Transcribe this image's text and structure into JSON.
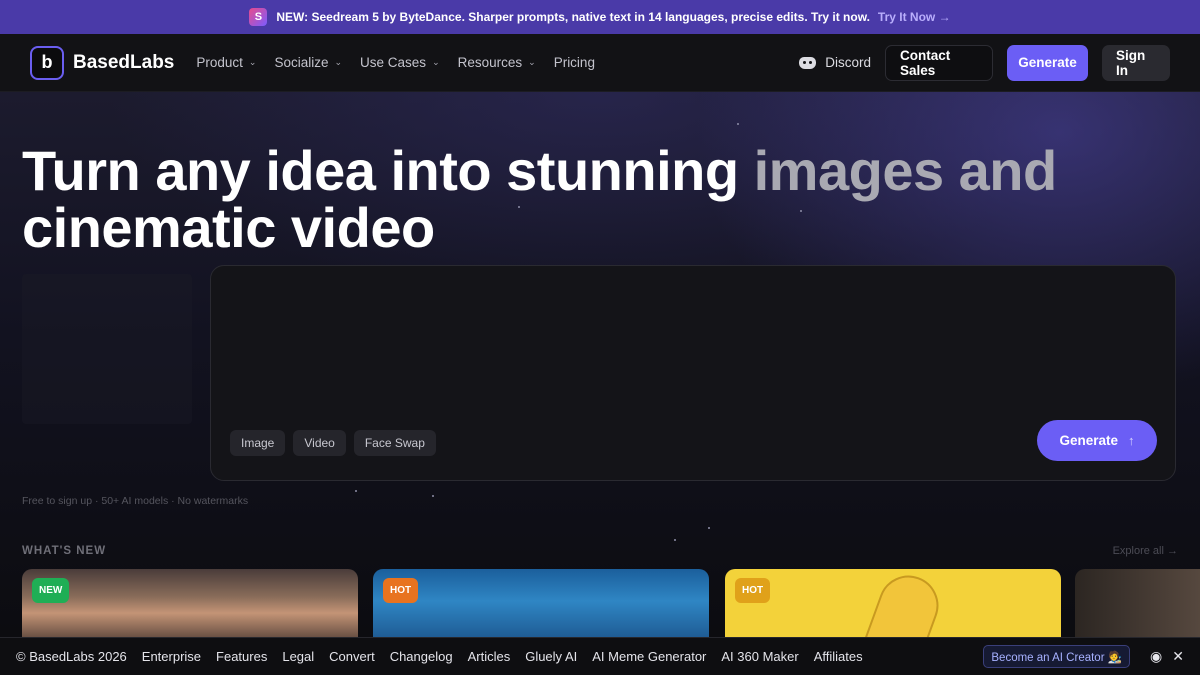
{
  "announcement": {
    "icon": "seedream-logo-icon",
    "text": "NEW: Seedream 5 by ByteDance. Sharper prompts, native text in 14 languages, precise edits. Try it now.",
    "link": "Try It Now →"
  },
  "nav": {
    "logo_text": "BasedLabs",
    "items": [
      {
        "label": "Product",
        "has_dropdown": true
      },
      {
        "label": "Socialize",
        "has_dropdown": true
      },
      {
        "label": "Use Cases",
        "has_dropdown": true
      },
      {
        "label": "Resources",
        "has_dropdown": true
      },
      {
        "label": "Pricing",
        "has_dropdown": false
      }
    ],
    "discord": "Discord",
    "contact_sales": "Contact Sales",
    "generate": "Generate",
    "sign_in": "Sign In"
  },
  "hero": {
    "title_bright": "Turn any idea into stunning ",
    "title_dim": "images and",
    "title_line2": "cinematic video"
  },
  "prompt": {
    "chips": [
      "Image",
      "Video",
      "Face Swap"
    ],
    "generate": "Generate",
    "generate_icon": "arrow-up-icon"
  },
  "tagline": "Free to sign up · 50+ AI models · No watermarks",
  "whats_new": {
    "label": "WHAT'S NEW",
    "explore": "Explore all →",
    "cards": [
      {
        "badge": "NEW"
      },
      {
        "badge": "HOT"
      },
      {
        "badge": "HOT"
      }
    ]
  },
  "footer": {
    "copyright": "© BasedLabs 2026",
    "links": [
      "Enterprise",
      "Features",
      "Legal",
      "Convert",
      "Changelog",
      "Articles",
      "Gluely AI",
      "AI Meme Generator",
      "AI 360 Maker",
      "Affiliates"
    ],
    "creator_button": "Become an AI Creator 🧑‍🎨",
    "social_icons": [
      "discord-icon",
      "x-icon"
    ]
  },
  "colors": {
    "accent": "#6b5ef5",
    "announcement_bg": "#4a3aa8",
    "badge_new": "#1fae55",
    "badge_hot": "#e8731f"
  }
}
